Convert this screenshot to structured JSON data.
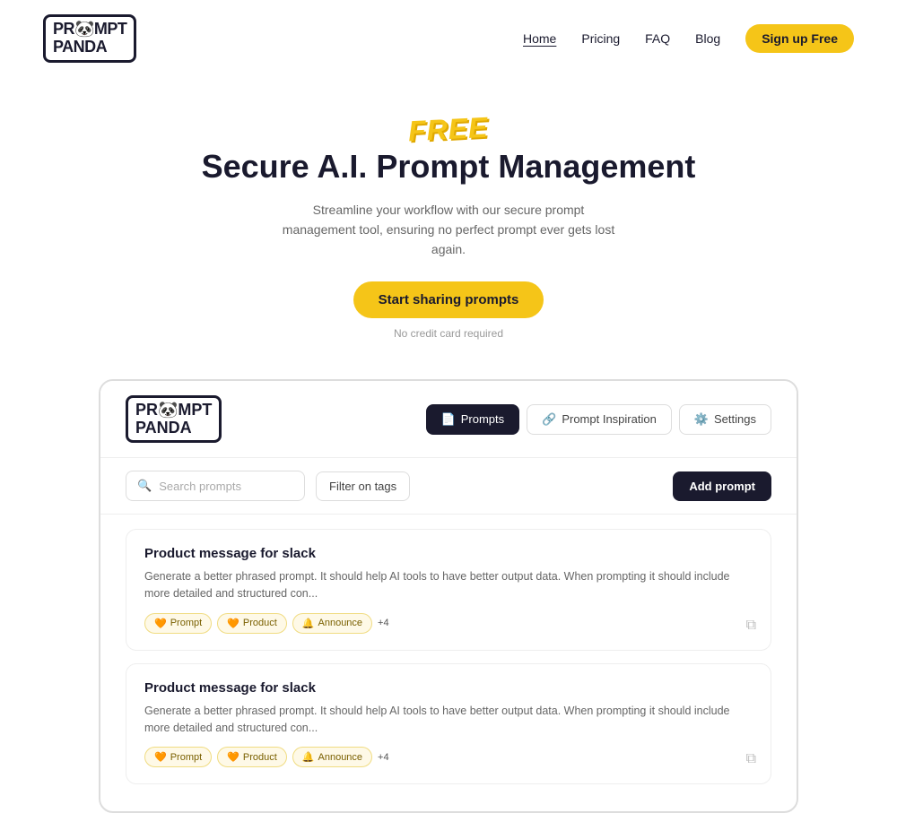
{
  "nav": {
    "logo_line1": "PR🐼MPT",
    "logo_line2": "PANDA",
    "links": [
      {
        "label": "Home",
        "active": true
      },
      {
        "label": "Pricing",
        "active": false
      },
      {
        "label": "FAQ",
        "active": false
      },
      {
        "label": "Blog",
        "active": false
      }
    ],
    "signup_label": "Sign up Free"
  },
  "hero": {
    "free_badge": "FREE",
    "title": "Secure A.I. Prompt Management",
    "subtitle": "Streamline your workflow with our secure prompt management tool, ensuring no perfect prompt ever gets lost again.",
    "cta_label": "Start sharing prompts",
    "note": "No credit card required"
  },
  "mockup": {
    "logo_line1": "PR🐼MPT",
    "logo_line2": "PANDA",
    "tabs": [
      {
        "label": "Prompts",
        "icon": "📄",
        "active": true
      },
      {
        "label": "Prompt Inspiration",
        "icon": "🔗",
        "active": false
      },
      {
        "label": "Settings",
        "icon": "⚙️",
        "active": false
      }
    ],
    "search_placeholder": "Search prompts",
    "filter_label": "Filter on tags",
    "add_prompt_label": "Add prompt",
    "cards": [
      {
        "title": "Product message for slack",
        "description": "Generate a better phrased prompt. It should help AI tools to have better output data. When prompting  it should include more detailed and structured con...",
        "tags": [
          {
            "label": "Prompt",
            "emoji": "🧡"
          },
          {
            "label": "Product",
            "emoji": "🧡"
          },
          {
            "label": "Announce",
            "emoji": "🔔"
          }
        ],
        "extra_tags": "+4"
      },
      {
        "title": "Product message for slack",
        "description": "Generate a better phrased prompt. It should help AI tools to have better output data. When prompting  it should include more detailed and structured con...",
        "tags": [
          {
            "label": "Prompt",
            "emoji": "🧡"
          },
          {
            "label": "Product",
            "emoji": "🧡"
          },
          {
            "label": "Announce",
            "emoji": "🔔"
          }
        ],
        "extra_tags": "+4"
      }
    ]
  }
}
